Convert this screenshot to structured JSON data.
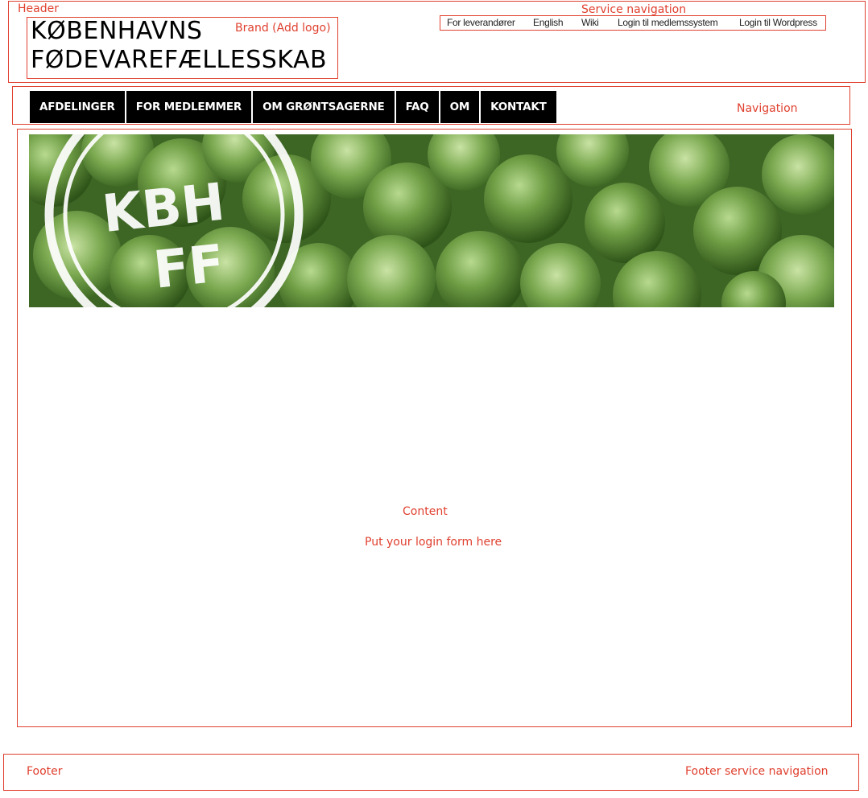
{
  "header": {
    "label": "Header",
    "brand": {
      "line1": "KØBENHAVNS",
      "line2": "FØDEVAREFÆLLESSKAB",
      "label": "Brand (Add logo)"
    }
  },
  "service_nav": {
    "label": "Service navigation",
    "links": [
      "For leverandører",
      "English",
      "Wiki",
      "Login til medlemssystem",
      "Login til Wordpress"
    ]
  },
  "navigation": {
    "label": "Navigation",
    "items": [
      "AFDELINGER",
      "FOR MEDLEMMER",
      "OM GRØNTSAGERNE",
      "FAQ",
      "OM",
      "KONTAKT"
    ]
  },
  "banner": {
    "stamp_line1": "KBH",
    "stamp_line2": "FF",
    "icon": "brussels-sprouts-photo"
  },
  "content": {
    "label": "Content",
    "login_note": "Put your login form here"
  },
  "footer": {
    "label": "Footer",
    "service_label": "Footer service navigation"
  },
  "colors": {
    "wireframe": "#e0402f",
    "nav_bg": "#000000",
    "nav_text": "#ffffff"
  }
}
